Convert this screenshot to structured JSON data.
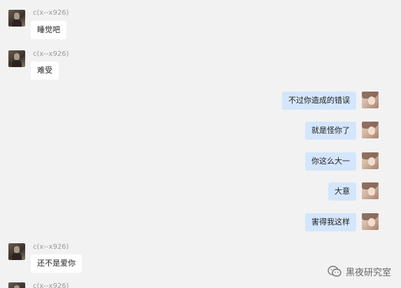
{
  "messages": [
    {
      "side": "left",
      "sender": "c(x--x926)",
      "text": "睡觉吧"
    },
    {
      "side": "left",
      "sender": "c(x--x926)",
      "text": "难受"
    },
    {
      "side": "right",
      "text": "不过你造成的错误"
    },
    {
      "side": "right",
      "text": "就是怪你了"
    },
    {
      "side": "right",
      "text": "你这么大一"
    },
    {
      "side": "right",
      "text": "大意"
    },
    {
      "side": "right",
      "text": "害得我这样"
    },
    {
      "side": "left",
      "sender": "c(x--x926)",
      "text": "还不是爱你"
    },
    {
      "side": "left",
      "sender": "c(x--x926)",
      "text": ""
    }
  ],
  "watermark": {
    "text": "黑夜研究室",
    "icon": "wechat-logo-icon"
  },
  "colors": {
    "background": "#f2f2f2",
    "bubble_left": "#ffffff",
    "bubble_right": "#d4e6fb",
    "nickname": "#9a9a9a"
  }
}
